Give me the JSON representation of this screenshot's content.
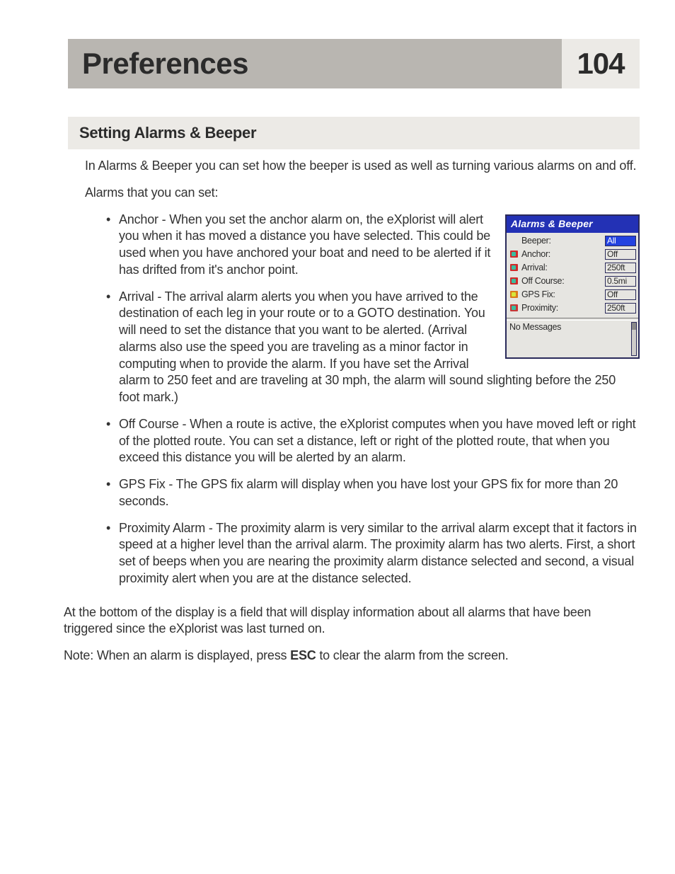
{
  "header": {
    "title": "Preferences",
    "page_number": "104"
  },
  "section": {
    "title": "Setting Alarms & Beeper"
  },
  "paragraphs": {
    "intro": "In Alarms & Beeper you can set how the beeper is used as well as turning various alarms on and off.",
    "alarms_lead": "Alarms that you can set:",
    "bottom": "At the bottom of the display is a field that will display information about all alarms that have been triggered since the eXplorist was last turned on.",
    "note_pre": "Note:  When an alarm is displayed, press ",
    "note_esc": "ESC",
    "note_post": " to clear the alarm from the screen."
  },
  "bullets": {
    "anchor": "Anchor - When you set the anchor alarm on, the eXplorist will alert you when it has moved a distance you have selected.  This could be used when you have anchored your boat and need to be alerted if it has drifted from it's anchor point.",
    "arrival": "Arrival - The arrival alarm alerts you when you have arrived to the destination of each leg in your route or to a GOTO destination.  You will need to set the distance that you want to be alerted.  (Arrival alarms also use the speed you are traveling as a minor factor in computing when to provide the alarm.  If you have set the Arrival alarm to 250 feet and are traveling at 30 mph, the alarm will sound slighting before the 250 foot mark.)",
    "offcourse": "Off Course - When a route is active, the eXplorist computes when you have moved left or right of the plotted route.  You can set a distance, left or right of the plotted route, that when you exceed this distance you will be alerted by an alarm.",
    "gpsfix": "GPS Fix - The GPS fix alarm will display when you have lost your GPS fix for more than 20 seconds.",
    "proximity": "Proximity Alarm - The proximity alarm is very similar to the arrival alarm except that it factors in speed at a higher level than the arrival alarm.  The proximity alarm has two alerts.  First, a short set of beeps when you are nearing the proximity alarm distance selected and second, a visual proximity alert when you are at the distance selected."
  },
  "device": {
    "title": "Alarms & Beeper",
    "rows": [
      {
        "label": "Beeper:",
        "value": "All",
        "selected": true,
        "icon": ""
      },
      {
        "label": "Anchor:",
        "value": "Off",
        "selected": false,
        "icon": "red"
      },
      {
        "label": "Arrival:",
        "value": "250ft",
        "selected": false,
        "icon": "red"
      },
      {
        "label": "Off Course:",
        "value": "0.5mi",
        "selected": false,
        "icon": "red"
      },
      {
        "label": "GPS Fix:",
        "value": "Off",
        "selected": false,
        "icon": "orange"
      },
      {
        "label": "Proximity:",
        "value": "250ft",
        "selected": false,
        "icon": "red"
      }
    ],
    "message_area": "No Messages"
  }
}
